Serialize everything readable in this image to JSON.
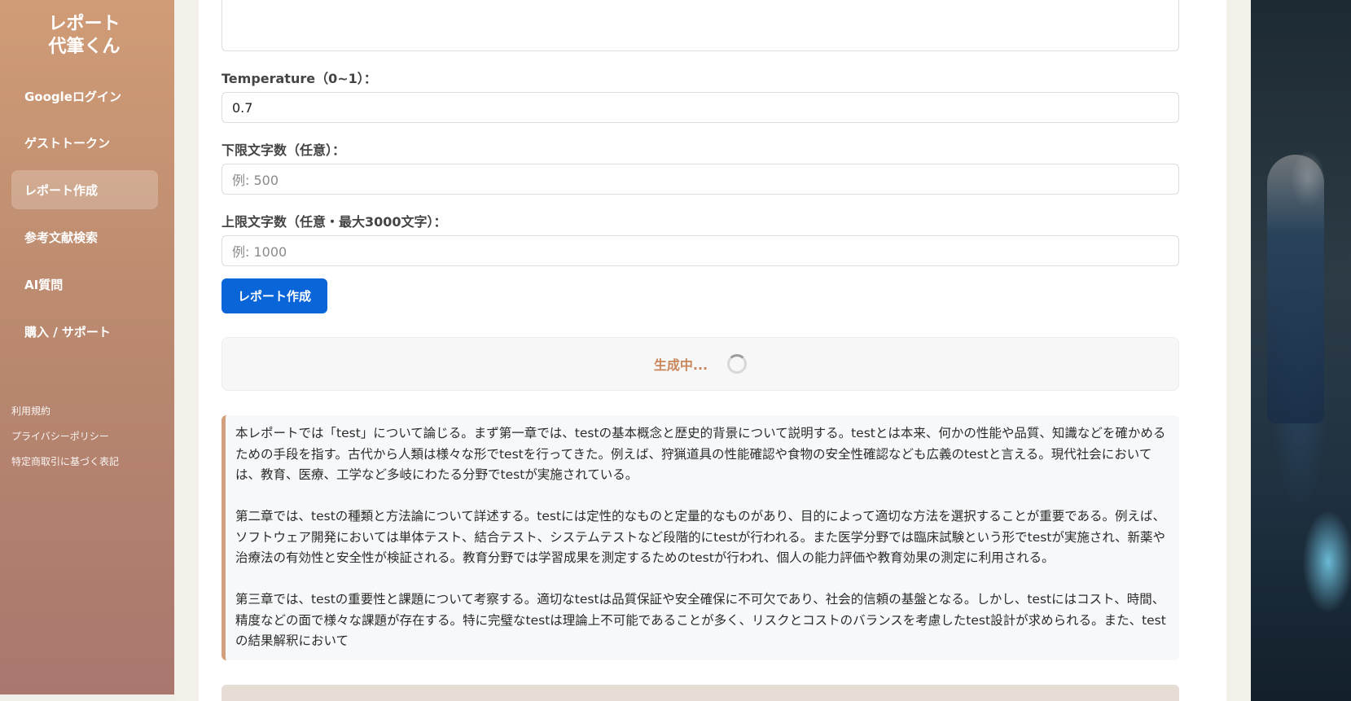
{
  "sidebar": {
    "brand_line1": "レポート",
    "brand_line2": "代筆くん",
    "items": [
      {
        "label": "Googleログイン"
      },
      {
        "label": "ゲストトークン"
      },
      {
        "label": "レポート作成"
      },
      {
        "label": "参考文献検索"
      },
      {
        "label": "AI質問"
      },
      {
        "label": "購入 / サポート"
      }
    ],
    "active_index": 2,
    "footer_links": [
      {
        "label": "利用規約"
      },
      {
        "label": "プライバシーポリシー"
      },
      {
        "label": "特定商取引に基づく表記"
      }
    ]
  },
  "form": {
    "temperature_label": "Temperature（0~1）：",
    "temperature_value": "0.7",
    "min_chars_label": "下限文字数（任意）：",
    "min_chars_placeholder": "例: 500",
    "max_chars_label": "上限文字数（任意・最大3000文字）：",
    "max_chars_placeholder": "例: 1000",
    "submit_label": "レポート作成"
  },
  "status": {
    "text": "生成中..."
  },
  "result": {
    "paragraphs": [
      "本レポートでは「test」について論じる。まず第一章では、testの基本概念と歴史的背景について説明する。testとは本来、何かの性能や品質、知識などを確かめるための手段を指す。古代から人類は様々な形でtestを行ってきた。例えば、狩猟道具の性能確認や食物の安全性確認なども広義のtestと言える。現代社会においては、教育、医療、工学など多岐にわたる分野でtestが実施されている。",
      "第二章では、testの種類と方法論について詳述する。testには定性的なものと定量的なものがあり、目的によって適切な方法を選択することが重要である。例えば、ソフトウェア開発においては単体テスト、結合テスト、システムテストなど段階的にtestが行われる。また医学分野では臨床試験という形でtestが実施され、新薬や治療法の有効性と安全性が検証される。教育分野では学習成果を測定するためのtestが行われ、個人の能力評価や教育効果の測定に利用される。",
      "第三章では、testの重要性と課題について考察する。適切なtestは品質保証や安全確保に不可欠であり、社会的信頼の基盤となる。しかし、testにはコスト、時間、精度などの面で様々な課題が存在する。特に完璧なtestは理論上不可能であることが多く、リスクとコストのバランスを考慮したtest設計が求められる。また、testの結果解釈において"
    ]
  }
}
